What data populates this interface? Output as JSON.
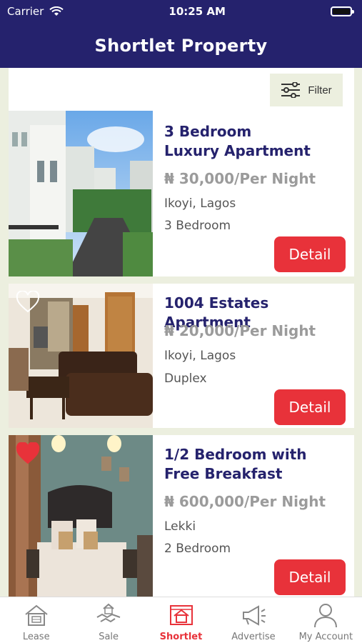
{
  "status_bar": {
    "carrier": "Carrier",
    "time": "10:25 AM"
  },
  "header": {
    "title": "Shortlet Property"
  },
  "filter": {
    "label": "Filter",
    "icon": "sliders-icon"
  },
  "listings": [
    {
      "title_line1": "3 Bedroom",
      "title_line2": "Luxury Apartment",
      "price": "₦ 30,000/Per Night",
      "location": "Ikoyi, Lagos",
      "type": "3 Bedroom",
      "detail_label": "Detail",
      "favorite": "none"
    },
    {
      "title_line1": "1004 Estates Apartment",
      "title_line2": "",
      "price": "₦ 20,000/Per Night",
      "location": "Ikoyi, Lagos",
      "type": "Duplex",
      "detail_label": "Detail",
      "favorite": "outline"
    },
    {
      "title_line1": "1/2 Bedroom with",
      "title_line2": "Free Breakfast",
      "price": "₦ 600,000/Per Night",
      "location": "Lekki",
      "type": "2 Bedroom",
      "detail_label": "Detail",
      "favorite": "filled"
    }
  ],
  "tabs": [
    {
      "label": "Lease",
      "icon": "lease-house-icon",
      "active": false
    },
    {
      "label": "Sale",
      "icon": "sale-handshake-icon",
      "active": false
    },
    {
      "label": "Shortlet",
      "icon": "shortlet-house-icon",
      "active": true
    },
    {
      "label": "Advertise",
      "icon": "megaphone-icon",
      "active": false
    },
    {
      "label": "My Account",
      "icon": "user-icon",
      "active": false
    }
  ],
  "colors": {
    "header_bg": "#25226d",
    "accent": "#e8323a",
    "page_bg": "#ecefdf"
  }
}
